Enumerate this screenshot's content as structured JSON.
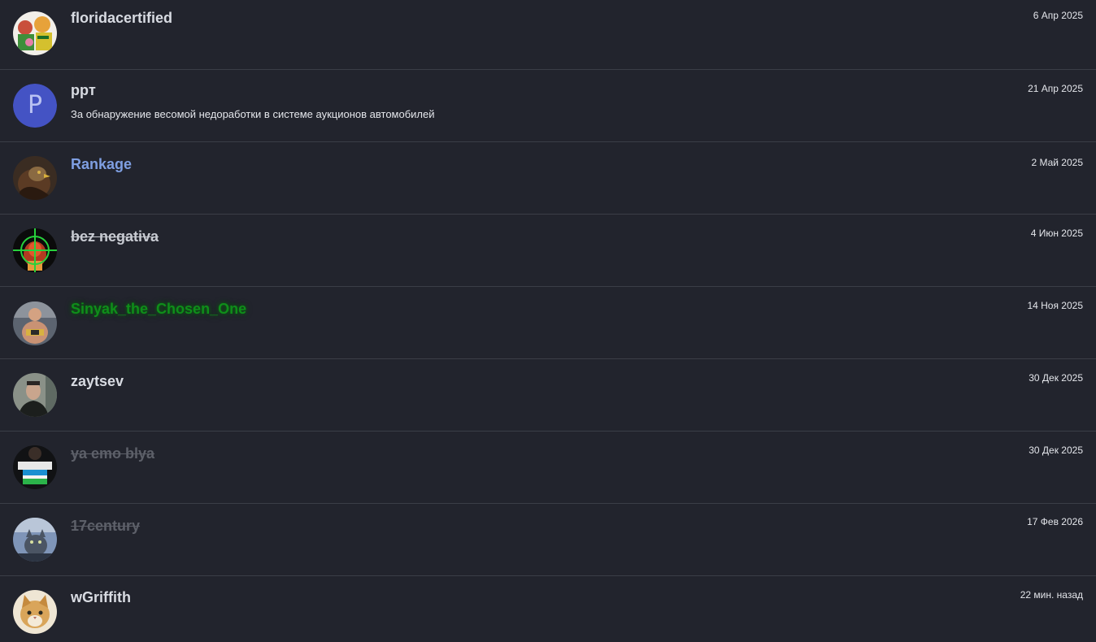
{
  "rows": [
    {
      "username": "floridacertified",
      "date": "6 Апр 2025",
      "comment": "",
      "avatar_icon": "cartoon-characters-avatar"
    },
    {
      "username": "ppт",
      "date": "21 Апр 2025",
      "comment": "За обнаружение весомой недоработки в системе аукционов автомобилей",
      "avatar_letter": "P",
      "avatar_color": "#4453c4"
    },
    {
      "username": "Rankage",
      "date": "2 Май 2025",
      "comment": "",
      "avatar_icon": "eagle-avatar",
      "name_color": "#7f9fe2"
    },
    {
      "username": "bez negativa",
      "date": "4 Июн 2025",
      "comment": "",
      "avatar_icon": "crosshair-avatar"
    },
    {
      "username": "Sinyak_the_Chosen_One",
      "date": "14 Ноя 2025",
      "comment": "",
      "avatar_icon": "fighter-avatar",
      "name_color": "#0f8e1a"
    },
    {
      "username": "zaytsev",
      "date": "30 Дек 2025",
      "comment": "",
      "avatar_icon": "man-portrait-avatar"
    },
    {
      "username": "ya emo blya",
      "date": "30 Дек 2025",
      "comment": "",
      "avatar_icon": "flag-shirt-avatar"
    },
    {
      "username": "17century",
      "date": "17 Фев 2026",
      "comment": "",
      "avatar_icon": "cat-car-avatar"
    },
    {
      "username": "wGriffith",
      "date": "22 мин. назад",
      "comment": "",
      "avatar_icon": "cat-face-avatar"
    }
  ]
}
